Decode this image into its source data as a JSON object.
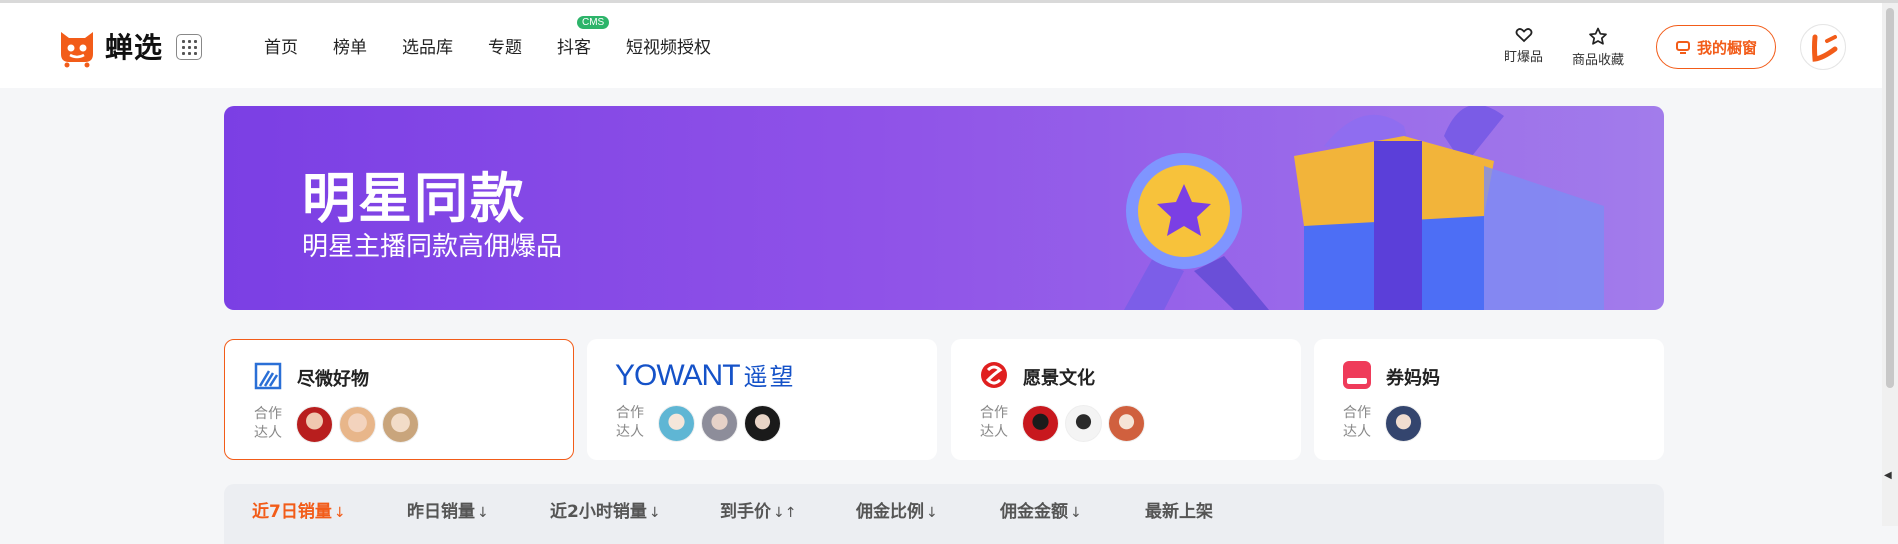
{
  "brand": {
    "name": "蝉选",
    "accent": "#f25c19"
  },
  "nav": {
    "items": [
      "首页",
      "榜单",
      "选品库",
      "专题",
      "抖客",
      "短视频授权"
    ],
    "badge": "CMS"
  },
  "header": {
    "hot_label": "盯爆品",
    "fav_label": "商品收藏",
    "window_label": "我的橱窗"
  },
  "banner": {
    "title": "明星同款",
    "subtitle": "明星主播同款高佣爆品",
    "gradient": [
      "#7b3fe4",
      "#a27ceb"
    ]
  },
  "partners": {
    "label": "合作达人",
    "cards": [
      {
        "name": "尽微好物",
        "logo": "jinwei-logo",
        "avatars": 3
      },
      {
        "name": "YOWANT 遥望",
        "logo_text": "YOWANT",
        "logo_cn": "遥望",
        "avatars": 3
      },
      {
        "name": "愿景文化",
        "logo": "yuanjing-logo",
        "avatars": 3
      },
      {
        "name": "券妈妈",
        "logo": "quanmama-logo",
        "logo_text": "券妈妈",
        "avatars": 1
      }
    ]
  },
  "sortbar": {
    "items": [
      "近7日销量",
      "昨日销量",
      "近2小时销量",
      "到手价",
      "佣金比例",
      "佣金金额",
      "最新上架"
    ],
    "active": "近7日销量"
  }
}
